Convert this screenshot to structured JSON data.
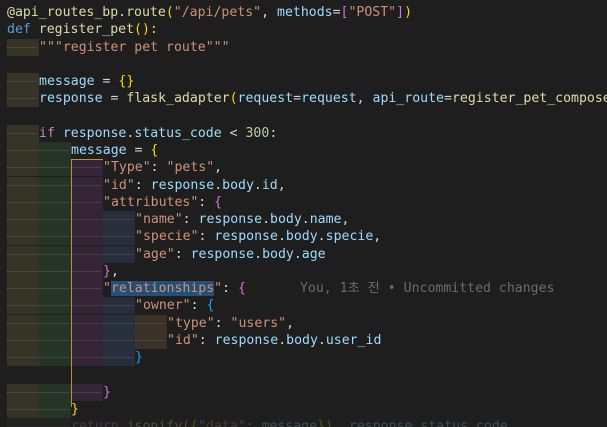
{
  "editor": {
    "colors": {
      "background": "#1e1e1e",
      "keyword": "#c586c0",
      "function": "#dcdcaa",
      "string": "#ce9178",
      "variable": "#9cdcfe",
      "number": "#b5cea8",
      "operator": "#d4d4d4",
      "bracket_yellow": "#ffd700",
      "bracket_pink": "#da70d6",
      "bracket_blue": "#179fff",
      "selection": "#264f78",
      "blame": "#6b6b6b"
    },
    "lines": [
      {
        "indent": 0,
        "tokens": [
          {
            "t": "@api_routes_bp",
            "c": "#dcdcaa"
          },
          {
            "t": ".",
            "c": "#d4d4d4"
          },
          {
            "t": "route",
            "c": "#dcdcaa"
          },
          {
            "t": "(",
            "c": "#ffd700"
          },
          {
            "t": "\"/api/pets\"",
            "c": "#ce9178"
          },
          {
            "t": ", ",
            "c": "#d4d4d4"
          },
          {
            "t": "methods",
            "c": "#9cdcfe"
          },
          {
            "t": "=",
            "c": "#d4d4d4"
          },
          {
            "t": "[",
            "c": "#da70d6"
          },
          {
            "t": "\"POST\"",
            "c": "#ce9178"
          },
          {
            "t": "]",
            "c": "#da70d6"
          },
          {
            "t": ")",
            "c": "#ffd700"
          }
        ]
      },
      {
        "indent": 0,
        "tokens": [
          {
            "t": "def ",
            "c": "#569cd6"
          },
          {
            "t": "register_pet",
            "c": "#dcdcaa"
          },
          {
            "t": "():",
            "c": "#ffd700"
          }
        ]
      },
      {
        "indent": 1,
        "tokens": [
          {
            "t": "\"\"\"register pet route\"\"\"",
            "c": "#ce9178"
          }
        ]
      },
      {
        "indent": 0,
        "tokens": []
      },
      {
        "indent": 1,
        "tokens": [
          {
            "t": "message",
            "c": "#9cdcfe"
          },
          {
            "t": " = ",
            "c": "#d4d4d4"
          },
          {
            "t": "{}",
            "c": "#ffd700"
          }
        ]
      },
      {
        "indent": 1,
        "tokens": [
          {
            "t": "response",
            "c": "#9cdcfe"
          },
          {
            "t": " = ",
            "c": "#d4d4d4"
          },
          {
            "t": "flask_adapter",
            "c": "#dcdcaa"
          },
          {
            "t": "(",
            "c": "#ffd700"
          },
          {
            "t": "request",
            "c": "#9cdcfe"
          },
          {
            "t": "=",
            "c": "#d4d4d4"
          },
          {
            "t": "request",
            "c": "#9cdcfe"
          },
          {
            "t": ", ",
            "c": "#d4d4d4"
          },
          {
            "t": "api_route",
            "c": "#9cdcfe"
          },
          {
            "t": "=",
            "c": "#d4d4d4"
          },
          {
            "t": "register_pet_compose",
            "c": "#dcdcaa"
          }
        ]
      },
      {
        "indent": 0,
        "tokens": []
      },
      {
        "indent": 1,
        "tokens": [
          {
            "t": "if ",
            "c": "#c586c0"
          },
          {
            "t": "response",
            "c": "#9cdcfe"
          },
          {
            "t": ".",
            "c": "#d4d4d4"
          },
          {
            "t": "status_code",
            "c": "#9cdcfe"
          },
          {
            "t": " < ",
            "c": "#d4d4d4"
          },
          {
            "t": "300",
            "c": "#b5cea8"
          },
          {
            "t": ":",
            "c": "#d4d4d4"
          }
        ]
      },
      {
        "indent": 2,
        "tokens": [
          {
            "t": "message",
            "c": "#9cdcfe"
          },
          {
            "t": " = ",
            "c": "#d4d4d4"
          },
          {
            "t": "{",
            "c": "#ffd700"
          }
        ]
      },
      {
        "indent": 3,
        "tokens": [
          {
            "t": "\"Type\"",
            "c": "#ce9178"
          },
          {
            "t": ": ",
            "c": "#d4d4d4"
          },
          {
            "t": "\"pets\"",
            "c": "#ce9178"
          },
          {
            "t": ",",
            "c": "#d4d4d4"
          }
        ]
      },
      {
        "indent": 3,
        "tokens": [
          {
            "t": "\"id\"",
            "c": "#ce9178"
          },
          {
            "t": ": ",
            "c": "#d4d4d4"
          },
          {
            "t": "response",
            "c": "#9cdcfe"
          },
          {
            "t": ".",
            "c": "#d4d4d4"
          },
          {
            "t": "body",
            "c": "#9cdcfe"
          },
          {
            "t": ".",
            "c": "#d4d4d4"
          },
          {
            "t": "id",
            "c": "#9cdcfe"
          },
          {
            "t": ",",
            "c": "#d4d4d4"
          }
        ]
      },
      {
        "indent": 3,
        "tokens": [
          {
            "t": "\"attributes\"",
            "c": "#ce9178"
          },
          {
            "t": ": ",
            "c": "#d4d4d4"
          },
          {
            "t": "{",
            "c": "#da70d6"
          }
        ]
      },
      {
        "indent": 4,
        "tokens": [
          {
            "t": "\"name\"",
            "c": "#ce9178"
          },
          {
            "t": ": ",
            "c": "#d4d4d4"
          },
          {
            "t": "response",
            "c": "#9cdcfe"
          },
          {
            "t": ".",
            "c": "#d4d4d4"
          },
          {
            "t": "body",
            "c": "#9cdcfe"
          },
          {
            "t": ".",
            "c": "#d4d4d4"
          },
          {
            "t": "name",
            "c": "#9cdcfe"
          },
          {
            "t": ",",
            "c": "#d4d4d4"
          }
        ]
      },
      {
        "indent": 4,
        "tokens": [
          {
            "t": "\"specie\"",
            "c": "#ce9178"
          },
          {
            "t": ": ",
            "c": "#d4d4d4"
          },
          {
            "t": "response",
            "c": "#9cdcfe"
          },
          {
            "t": ".",
            "c": "#d4d4d4"
          },
          {
            "t": "body",
            "c": "#9cdcfe"
          },
          {
            "t": ".",
            "c": "#d4d4d4"
          },
          {
            "t": "specie",
            "c": "#9cdcfe"
          },
          {
            "t": ",",
            "c": "#d4d4d4"
          }
        ]
      },
      {
        "indent": 4,
        "tokens": [
          {
            "t": "\"age\"",
            "c": "#ce9178"
          },
          {
            "t": ": ",
            "c": "#d4d4d4"
          },
          {
            "t": "response",
            "c": "#9cdcfe"
          },
          {
            "t": ".",
            "c": "#d4d4d4"
          },
          {
            "t": "body",
            "c": "#9cdcfe"
          },
          {
            "t": ".",
            "c": "#d4d4d4"
          },
          {
            "t": "age",
            "c": "#9cdcfe"
          }
        ]
      },
      {
        "indent": 3,
        "tokens": [
          {
            "t": "}",
            "c": "#da70d6"
          },
          {
            "t": ",",
            "c": "#d4d4d4"
          }
        ]
      },
      {
        "indent": 3,
        "tokens": [
          {
            "t": "\"",
            "c": "#ce9178"
          },
          {
            "t": "relationships",
            "c": "#ce9178",
            "hl": true
          },
          {
            "t": "\"",
            "c": "#ce9178"
          },
          {
            "t": ": ",
            "c": "#d4d4d4"
          },
          {
            "t": "{",
            "c": "#da70d6"
          }
        ],
        "blame": "You, 1초 전 • Uncommitted changes"
      },
      {
        "indent": 4,
        "tokens": [
          {
            "t": "\"owner\"",
            "c": "#ce9178"
          },
          {
            "t": ": ",
            "c": "#d4d4d4"
          },
          {
            "t": "{",
            "c": "#179fff"
          }
        ]
      },
      {
        "indent": 5,
        "tokens": [
          {
            "t": "\"type\"",
            "c": "#ce9178"
          },
          {
            "t": ": ",
            "c": "#d4d4d4"
          },
          {
            "t": "\"users\"",
            "c": "#ce9178"
          },
          {
            "t": ",",
            "c": "#d4d4d4"
          }
        ]
      },
      {
        "indent": 5,
        "tokens": [
          {
            "t": "\"id\"",
            "c": "#ce9178"
          },
          {
            "t": ": ",
            "c": "#d4d4d4"
          },
          {
            "t": "response",
            "c": "#9cdcfe"
          },
          {
            "t": ".",
            "c": "#d4d4d4"
          },
          {
            "t": "body",
            "c": "#9cdcfe"
          },
          {
            "t": ".",
            "c": "#d4d4d4"
          },
          {
            "t": "user_id",
            "c": "#9cdcfe"
          }
        ]
      },
      {
        "indent": 4,
        "tokens": [
          {
            "t": "}",
            "c": "#179fff"
          }
        ]
      },
      {
        "indent": 0,
        "tokens": []
      },
      {
        "indent": 3,
        "tokens": [
          {
            "t": "}",
            "c": "#da70d6"
          }
        ]
      },
      {
        "indent": 2,
        "tokens": [
          {
            "t": "}",
            "c": "#ffd700"
          }
        ]
      },
      {
        "indent": 2,
        "fade": true,
        "tokens": [
          {
            "t": "return ",
            "c": "#c586c0"
          },
          {
            "t": "jsonify",
            "c": "#dcdcaa"
          },
          {
            "t": "({",
            "c": "#ffd700"
          },
          {
            "t": "\"data\"",
            "c": "#ce9178"
          },
          {
            "t": ": ",
            "c": "#d4d4d4"
          },
          {
            "t": "message",
            "c": "#9cdcfe"
          },
          {
            "t": "}), ",
            "c": "#ffd700"
          },
          {
            "t": "response",
            "c": "#9cdcfe"
          },
          {
            "t": ".",
            "c": "#d4d4d4"
          },
          {
            "t": "status_code",
            "c": "#9cdcfe"
          }
        ]
      }
    ]
  }
}
